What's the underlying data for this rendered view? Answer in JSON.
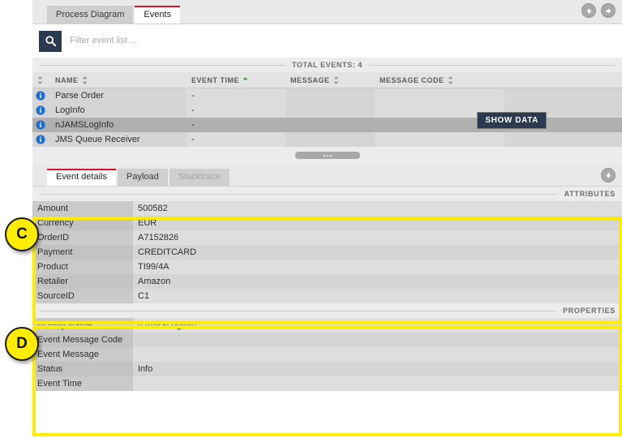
{
  "window": {
    "top_tabs": [
      {
        "label": "Process Diagram",
        "active": false
      },
      {
        "label": "Events",
        "active": true
      }
    ],
    "nav_buttons": [
      {
        "name": "up-arrow-icon",
        "title": "Up"
      },
      {
        "name": "right-arrow-icon",
        "title": "Forward"
      }
    ]
  },
  "filter": {
    "icon": "search-icon",
    "value": "",
    "placeholder": "Filter event list ..."
  },
  "events_section": {
    "total_label": "TOTAL EVENTS: 4",
    "columns": [
      {
        "label": "NAME",
        "sortable": true,
        "sorted": ""
      },
      {
        "label": "EVENT TIME",
        "sortable": true,
        "sorted": "asc"
      },
      {
        "label": "MESSAGE",
        "sortable": true,
        "sorted": ""
      },
      {
        "label": "MESSAGE CODE",
        "sortable": true,
        "sorted": ""
      }
    ],
    "rows": [
      {
        "icon": "info-icon",
        "name": "Parse Order",
        "event_time": "-",
        "message": "",
        "message_code": "",
        "selected": false
      },
      {
        "icon": "info-icon",
        "name": "LogInfo",
        "event_time": "-",
        "message": "",
        "message_code": "",
        "selected": false
      },
      {
        "icon": "info-icon",
        "name": "nJAMSLogInfo",
        "event_time": "-",
        "message": "",
        "message_code": "",
        "selected": true
      },
      {
        "icon": "info-icon",
        "name": "JMS Queue Receiver",
        "event_time": "-",
        "message": "",
        "message_code": "",
        "selected": false
      }
    ],
    "show_data_button": "SHOW DATA"
  },
  "splitter": {
    "name": "horizontal-splitter"
  },
  "detail_tabs": [
    {
      "label": "Event details",
      "active": true,
      "disabled": false
    },
    {
      "label": "Payload",
      "active": false,
      "disabled": false
    },
    {
      "label": "Stacktrace",
      "active": false,
      "disabled": true
    }
  ],
  "collapse_button": {
    "name": "down-arrow-icon"
  },
  "attributes": {
    "title": "ATTRIBUTES",
    "rows": [
      {
        "key": "Amount",
        "value": "500582"
      },
      {
        "key": "Currency",
        "value": "EUR"
      },
      {
        "key": "OrderID",
        "value": "A7152826"
      },
      {
        "key": "Payment",
        "value": "CREDITCARD"
      },
      {
        "key": "Product",
        "value": "TI99/4A"
      },
      {
        "key": "Retailer",
        "value": "Amazon"
      },
      {
        "key": "SourceID",
        "value": "C1"
      }
    ]
  },
  "properties": {
    "title": "PROPERTIES",
    "rows": [
      {
        "key": "Activity Name",
        "value": "nJAMSLogInfo"
      },
      {
        "key": "Event Message Code",
        "value": ""
      },
      {
        "key": "Event Message",
        "value": ""
      },
      {
        "key": "Status",
        "value": "Info"
      },
      {
        "key": "Event Time",
        "value": ""
      }
    ]
  },
  "annotations": [
    {
      "label": "C",
      "target": "attributes"
    },
    {
      "label": "D",
      "target": "properties"
    }
  ],
  "colors": {
    "accent_red": "#d0112b",
    "dark_navy": "#2b3a4f",
    "highlight_yellow": "#ffed00",
    "info_blue": "#1f6fd0",
    "sort_green": "#3f9c35"
  }
}
